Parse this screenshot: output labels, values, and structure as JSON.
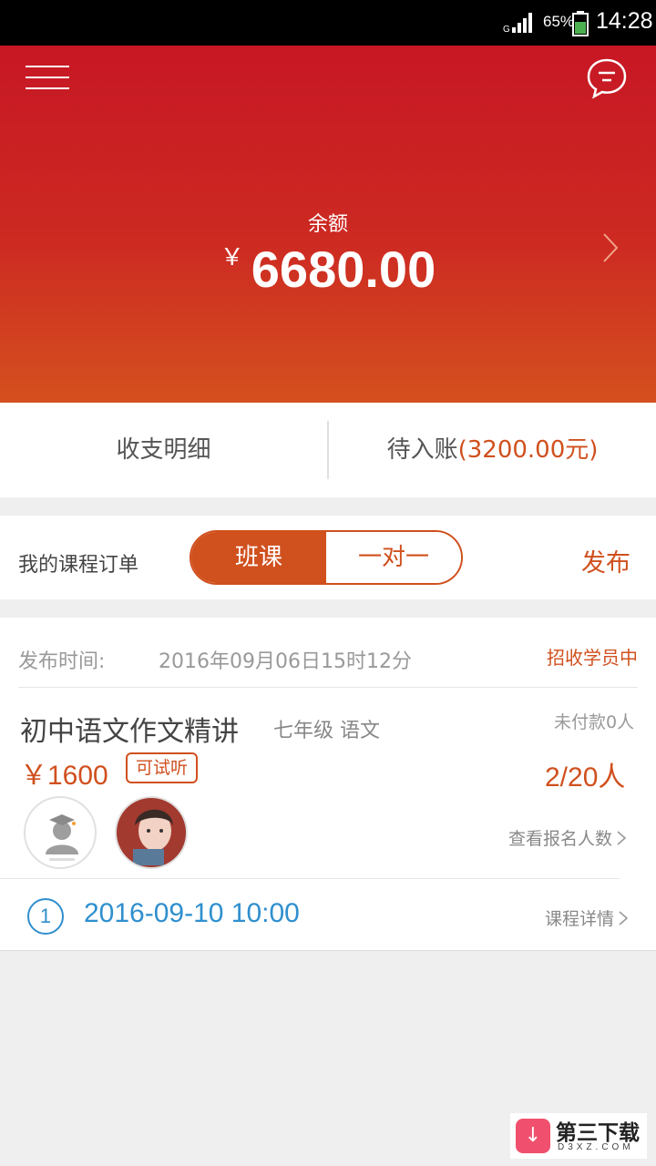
{
  "status_bar": {
    "battery": "65%",
    "time": "14:28"
  },
  "hero": {
    "balance_label": "余额",
    "currency": "￥",
    "balance": "6680.00",
    "icons": {
      "menu": "menu-icon",
      "message": "chat-bubble-icon",
      "chevron": "chevron-right-icon"
    }
  },
  "income": {
    "details_label": "收支明细",
    "pending_label": "待入账",
    "pending_amount": "(3200.00元)"
  },
  "orders": {
    "title": "我的课程订单",
    "tabs": [
      "班课",
      "一对一"
    ],
    "active_tab": 0,
    "publish_label": "发布"
  },
  "order": {
    "publish_time_label": "发布时间:",
    "publish_time": "2016年09月06日15时12分",
    "status": "招收学员中",
    "course_name": "初中语文作文精讲",
    "meta": "七年级 语文",
    "unpaid": "未付款0人",
    "price": "￥1600",
    "trial_badge": "可试听",
    "enrolled": "2/20人",
    "view_enrolled": "查看报名人数",
    "session_number": "1",
    "session_time": "2016-09-10 10:00",
    "course_detail": "课程详情"
  },
  "watermark": {
    "name": "第三下载",
    "domain": "D3XZ.COM"
  },
  "colors": {
    "accent": "#d0501e",
    "hero_top": "#c71724",
    "link_blue": "#2f8fce"
  }
}
